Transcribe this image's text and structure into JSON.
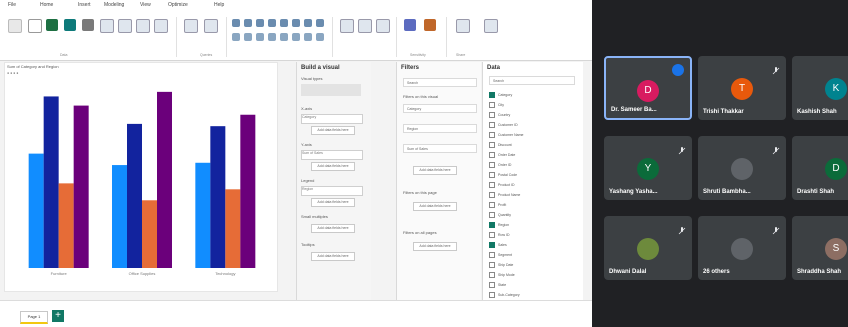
{
  "ribbon": {
    "tabs": [
      "File",
      "Home",
      "Insert",
      "Modeling",
      "View",
      "Optimize",
      "Help"
    ],
    "groups": [
      "Clipboard",
      "Data",
      "Queries",
      "Insert",
      "Calculations",
      "Sensitivity",
      "Share",
      "Copilot"
    ],
    "buttons": [
      "Paste",
      "Get data",
      "Excel",
      "OneLake",
      "SQL Server",
      "Enter data",
      "Dataverse",
      "Recent",
      "Transform",
      "Refresh",
      "New visual",
      "Text box",
      "More visuals",
      "New measure",
      "Quick measure",
      "Sensitivity",
      "Publish",
      "Copilot"
    ]
  },
  "canvas": {
    "title": "Sum of Category and Region",
    "legend": "● ● ● ●"
  },
  "build_pane": {
    "title": "Build a visual",
    "visual_types_label": "Visual types",
    "x_axis_label": "X-axis",
    "x_axis_value": "Category",
    "y_axis_label": "Y-axis",
    "y_axis_value": "Sum of Sales",
    "legend_label": "Legend",
    "legend_value": "Region",
    "small_multiples_label": "Small multiples",
    "tooltips_label": "Tooltips",
    "add_data": "Add data fields here"
  },
  "filters_pane": {
    "title": "Filters",
    "search_placeholder": "Search",
    "section_visual": "Filters on this visual",
    "section_page": "Filters on this page",
    "section_all": "Filters on all pages",
    "cards": [
      "Category",
      "Region",
      "Sum of Sales"
    ],
    "add_data": "Add data fields here"
  },
  "data_pane": {
    "title": "Data",
    "search_placeholder": "Search",
    "items": [
      {
        "label": "Category",
        "checked": true
      },
      {
        "label": "City",
        "checked": false
      },
      {
        "label": "Country",
        "checked": false
      },
      {
        "label": "Customer ID",
        "checked": false
      },
      {
        "label": "Customer Name",
        "checked": false
      },
      {
        "label": "Discount",
        "checked": false
      },
      {
        "label": "Order Date",
        "checked": false
      },
      {
        "label": "Order ID",
        "checked": false
      },
      {
        "label": "Postal Code",
        "checked": false
      },
      {
        "label": "Product ID",
        "checked": false
      },
      {
        "label": "Product Name",
        "checked": false
      },
      {
        "label": "Profit",
        "checked": false
      },
      {
        "label": "Quantity",
        "checked": false
      },
      {
        "label": "Region",
        "checked": true
      },
      {
        "label": "Row ID",
        "checked": false
      },
      {
        "label": "Sales",
        "checked": true
      },
      {
        "label": "Segment",
        "checked": false
      },
      {
        "label": "Ship Date",
        "checked": false
      },
      {
        "label": "Ship Mode",
        "checked": false
      },
      {
        "label": "State",
        "checked": false
      },
      {
        "label": "Sub-Category",
        "checked": false
      }
    ]
  },
  "statusbar": {
    "page_tab": "Page 1",
    "add_page": "+"
  },
  "chart_data": {
    "type": "bar",
    "categories": [
      "Furniture",
      "Office Supplies",
      "Technology"
    ],
    "series": [
      {
        "values": [
          250,
          225,
          230
        ],
        "color": "#118dff"
      },
      {
        "values": [
          375,
          315,
          310
        ],
        "color": "#12239e"
      },
      {
        "values": [
          185,
          148,
          172
        ],
        "color": "#e66c37"
      },
      {
        "values": [
          355,
          385,
          335
        ],
        "color": "#6b007b"
      }
    ],
    "ylim": [
      0,
      400
    ]
  },
  "meeting": {
    "participants": [
      {
        "name": "Dr. Sameer Ba...",
        "initial": "D",
        "color": "#d81b60",
        "active": true
      },
      {
        "name": "Trishi Thakkar",
        "initial": "T",
        "color": "#e8590c",
        "active": false
      },
      {
        "name": "Kashish Shah",
        "initial": "K",
        "color": "#00838f",
        "active": false
      },
      {
        "name": "Yashang Yasha...",
        "initial": "Y",
        "color": "#0b6b3a",
        "active": false
      },
      {
        "name": "Shruti Bambha...",
        "initial": "",
        "color": "#5f6368",
        "active": false
      },
      {
        "name": "Drashti Shah",
        "initial": "D",
        "color": "#0b6b3a",
        "active": false
      },
      {
        "name": "Dhwani Dalal",
        "initial": "",
        "color": "#6d8a3c",
        "active": false
      },
      {
        "name": "26 others",
        "initial": "",
        "color": "#5f6368",
        "active": false
      },
      {
        "name": "Shraddha Shah",
        "initial": "S",
        "color": "#8d6e63",
        "active": false
      }
    ]
  },
  "colors": {
    "accent": "#117865",
    "meet_bg": "#202124",
    "tile_bg": "#3c4043",
    "active_border": "#8ab4f8"
  }
}
